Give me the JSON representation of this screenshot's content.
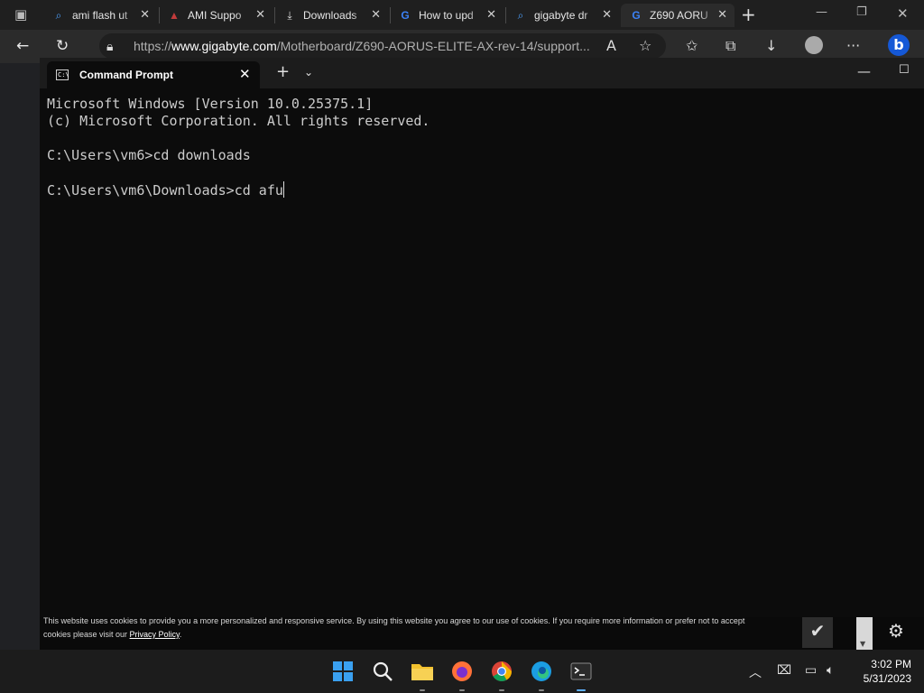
{
  "browser": {
    "tabs": [
      {
        "icon": "search-icon",
        "label": "ami flash ut"
      },
      {
        "icon": "ami-icon",
        "label": "AMI Suppo"
      },
      {
        "icon": "download-icon",
        "label": "Downloads"
      },
      {
        "icon": "gigabyte-icon",
        "label": "How to upd"
      },
      {
        "icon": "search-icon",
        "label": "gigabyte dr"
      },
      {
        "icon": "gigabyte-icon",
        "label": "Z690 AORU"
      }
    ],
    "url": {
      "prefix": "https://",
      "domain": "www.gigabyte.com",
      "path": "/Motherboard/Z690-AORUS-ELITE-AX-rev-14/support..."
    }
  },
  "cmd": {
    "tab_title": "Command Prompt",
    "lines": [
      "Microsoft Windows [Version 10.0.25375.1]",
      "(c) Microsoft Corporation. All rights reserved.",
      "",
      "C:\\Users\\vm6>cd downloads",
      "",
      "C:\\Users\\vm6\\Downloads>cd afu"
    ]
  },
  "cookie": {
    "text_before": "This website uses cookies to provide you a more personalized and responsive service. By using this website you agree to our use of cookies. If you require more information or prefer not to accept cookies please visit our ",
    "link": "Privacy Policy",
    "text_after": "."
  },
  "taskbar": {
    "time": "3:02 PM",
    "date": "5/31/2023"
  },
  "colors": {
    "console_bg": "#0c0c0c",
    "console_text": "#cccccc",
    "chrome_bg": "#2b2b2b"
  }
}
